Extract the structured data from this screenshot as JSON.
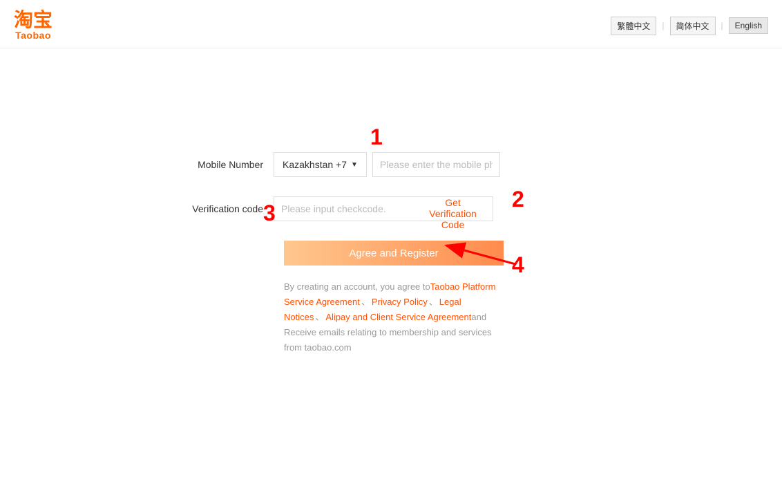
{
  "logo": {
    "cn": "淘宝",
    "en": "Taobao"
  },
  "lang": {
    "traditional": "繁體中文",
    "simplified": "简体中文",
    "english": "English"
  },
  "form": {
    "mobile_label": "Mobile Number",
    "country_selected": "Kazakhstan +7",
    "mobile_placeholder": "Please enter the mobile phone",
    "verify_label": "Verification code",
    "verify_placeholder": "Please input checkcode.",
    "get_code_label": "Get Verification Code",
    "submit_label": "Agree and Register"
  },
  "terms": {
    "prefix": "By creating an account, you agree to",
    "link1": "Taobao Platform Service Agreement",
    "link2": "Privacy Policy",
    "link3": "Legal Notices",
    "link4": "Alipay and Client Service Agreement",
    "suffix": "and Receive emails relating to membership and services from taobao.com",
    "sep": "、"
  },
  "annotations": {
    "a1": "1",
    "a2": "2",
    "a3": "3",
    "a4": "4"
  }
}
